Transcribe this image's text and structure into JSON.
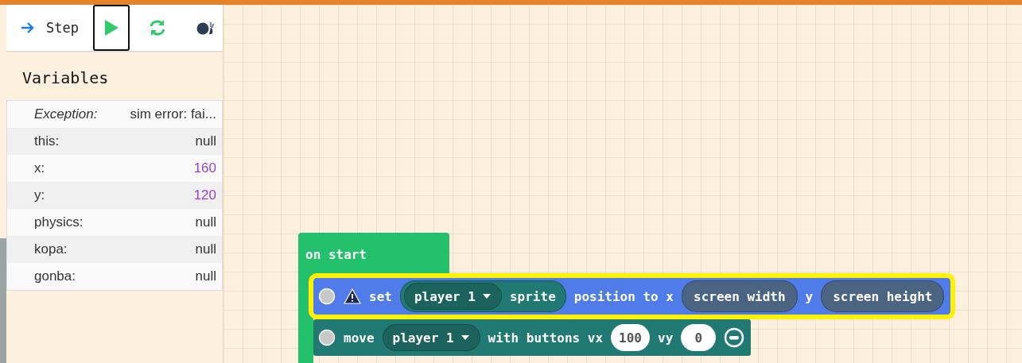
{
  "toolbar": {
    "buttons": [
      {
        "kind": "step",
        "label": "Step",
        "selected": false
      },
      {
        "kind": "run",
        "selected": true
      },
      {
        "kind": "restart",
        "selected": false
      },
      {
        "kind": "slow",
        "selected": false
      }
    ]
  },
  "variables": {
    "title": "Variables",
    "rows": [
      {
        "kind": "exception",
        "name": "Exception:",
        "value": "sim error: fai..."
      },
      {
        "kind": "plain",
        "name": "this:",
        "value": "null"
      },
      {
        "kind": "number",
        "name": "x:",
        "value": "160"
      },
      {
        "kind": "number",
        "name": "y:",
        "value": "120"
      },
      {
        "kind": "plain",
        "name": "physics:",
        "value": "null"
      },
      {
        "kind": "plain",
        "name": "kopa:",
        "value": "null"
      },
      {
        "kind": "plain",
        "name": "gonba:",
        "value": "null"
      }
    ]
  },
  "workspace": {
    "event_block": {
      "label": "on start",
      "statements": [
        {
          "color": "#4f7ce8",
          "highlighted": true,
          "warning": true,
          "parts": [
            {
              "kind": "label",
              "text": "set"
            },
            {
              "kind": "reporter",
              "color": "#207a73",
              "parts": [
                {
                  "kind": "dropdown",
                  "text": "player 1"
                },
                {
                  "kind": "label",
                  "text": "sprite"
                }
              ]
            },
            {
              "kind": "label",
              "text": "position to x"
            },
            {
              "kind": "reporter",
              "color": "#4a6482",
              "parts": [
                {
                  "kind": "label",
                  "text": "screen width"
                }
              ]
            },
            {
              "kind": "label",
              "text": "y"
            },
            {
              "kind": "reporter",
              "color": "#4a6482",
              "parts": [
                {
                  "kind": "label",
                  "text": "screen height"
                }
              ]
            }
          ]
        },
        {
          "color": "#207a73",
          "highlighted": false,
          "warning": false,
          "parts": [
            {
              "kind": "label",
              "text": "move"
            },
            {
              "kind": "dropdown",
              "text": "player 1"
            },
            {
              "kind": "label",
              "text": "with buttons vx"
            },
            {
              "kind": "number",
              "text": "100"
            },
            {
              "kind": "label",
              "text": "vy"
            },
            {
              "kind": "number",
              "text": "0"
            },
            {
              "kind": "remove"
            }
          ]
        }
      ]
    }
  }
}
